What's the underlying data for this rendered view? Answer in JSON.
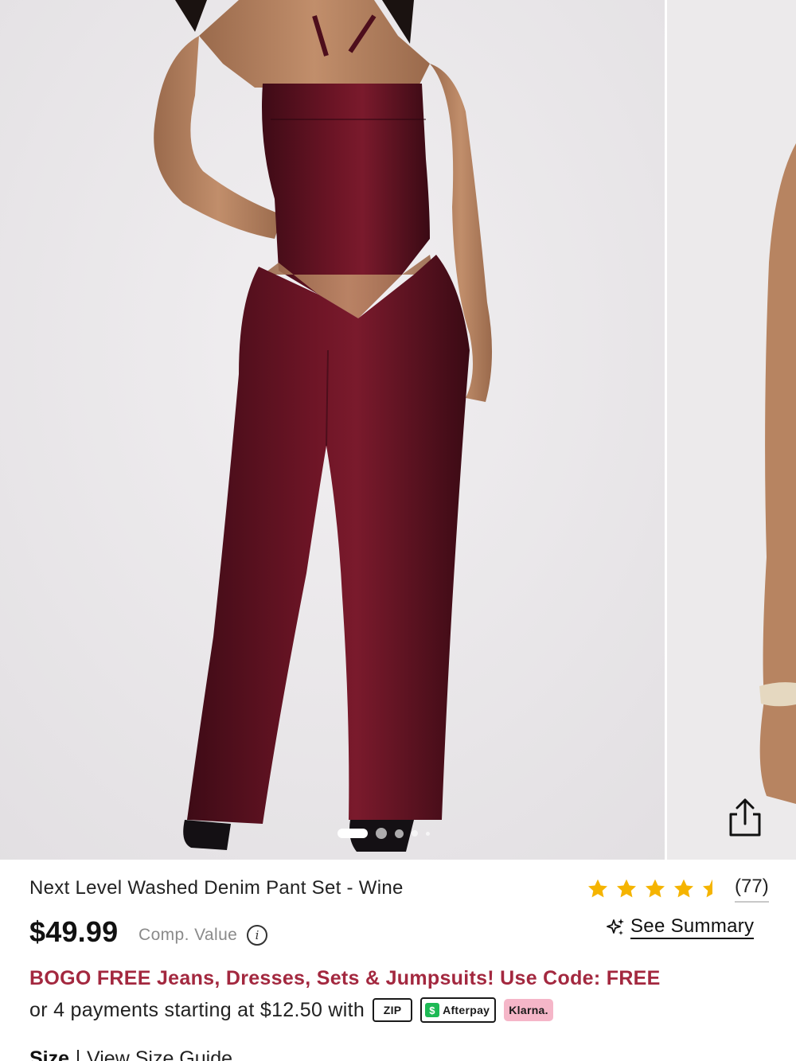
{
  "product": {
    "title": "Next Level Washed Denim Pant Set - Wine",
    "price": "$49.99",
    "comp_value_label": "Comp. Value",
    "rating": 4.5,
    "review_count": "(77)",
    "see_summary_label": "See Summary",
    "promo_text": "BOGO FREE Jeans, Dresses, Sets & Jumpsuits! Use Code: FREE",
    "payments_text": "or 4 payments starting at $12.50 with"
  },
  "payment_badges": {
    "zip": "ZIP",
    "afterpay": "Afterpay",
    "afterpay_icon": "$",
    "klarna": "Klarna."
  },
  "size": {
    "label": "Size",
    "guide_link": "View Size Guide"
  },
  "carousel": {
    "slide_count": 5,
    "active_index": 0
  },
  "icons": {
    "share": "share-icon",
    "info": "info-icon",
    "sparkle": "sparkle-icon",
    "star": "star-icon"
  },
  "colors": {
    "promo": "#a3283f",
    "star": "#f5b400",
    "garment": "#5a1020"
  }
}
